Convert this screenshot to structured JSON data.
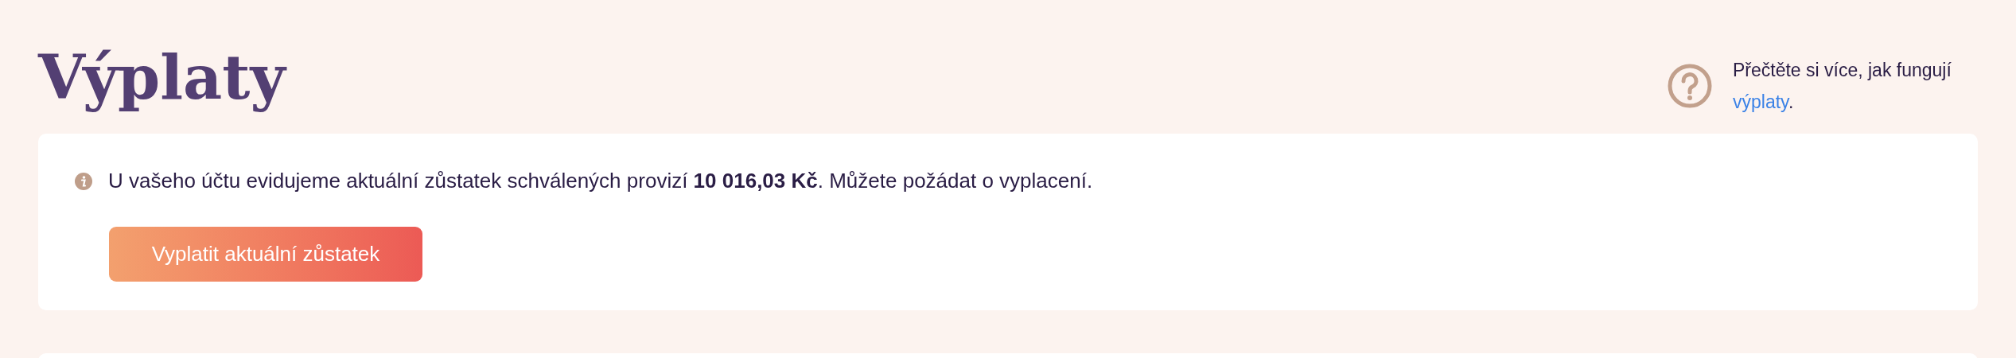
{
  "page_title": "Výplaty",
  "help": {
    "text": "Přečtěte si více, jak fungují",
    "link": "výplaty",
    "after": "."
  },
  "notice": {
    "text": "U vašeho účtu evidujeme aktuální zůstatek schválených provizí **10 016,03 Kč**. Můžete požádat o vyplacení.",
    "button": "Vyplatit aktuální zůstatek"
  }
}
